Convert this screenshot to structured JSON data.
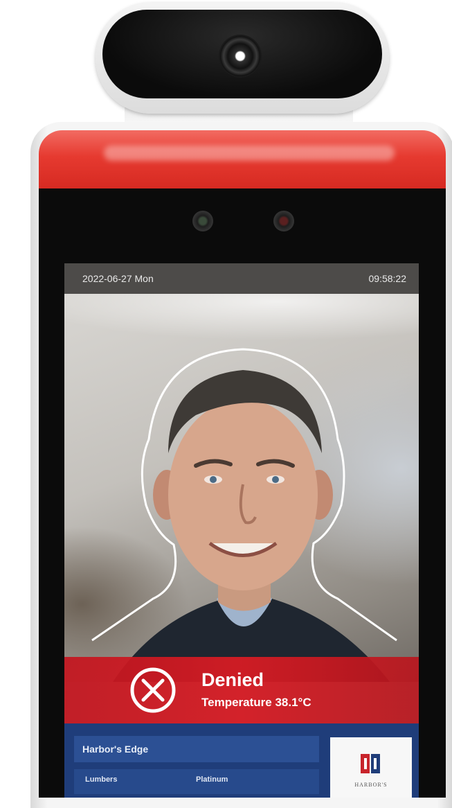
{
  "screen": {
    "date": "2022-06-27 Mon",
    "time": "09:58:22"
  },
  "result": {
    "status": "Denied",
    "detail": "Temperature 38.1°C",
    "icon": "denied-x-icon",
    "color": "#d21c24"
  },
  "info": {
    "name": "Harbor's Edge",
    "field_left": "Lumbers",
    "field_right": "Platinum",
    "logo_text": "HARBOR'S"
  },
  "device": {
    "status_light_color": "#e63a30"
  }
}
